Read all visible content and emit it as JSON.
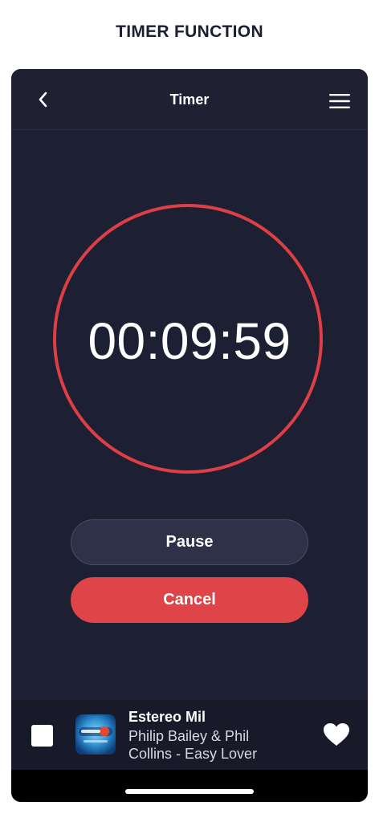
{
  "page": {
    "title": "TIMER FUNCTION"
  },
  "header": {
    "title": "Timer",
    "back_icon": "chevron-left-icon",
    "menu_icon": "hamburger-menu-icon"
  },
  "timer": {
    "display": "00:09:59",
    "ring_color": "#de3f44"
  },
  "actions": {
    "pause_label": "Pause",
    "cancel_label": "Cancel",
    "cancel_color": "#de4448"
  },
  "player": {
    "station": "Estereo Mil",
    "track": "Philip Bailey & Phil Collins - Easy Lover",
    "stop_icon": "stop-icon",
    "favorite_icon": "heart-icon"
  },
  "colors": {
    "background": "#1d1f33",
    "header": "#1f2132",
    "player": "#181929",
    "accent": "#de4448"
  }
}
